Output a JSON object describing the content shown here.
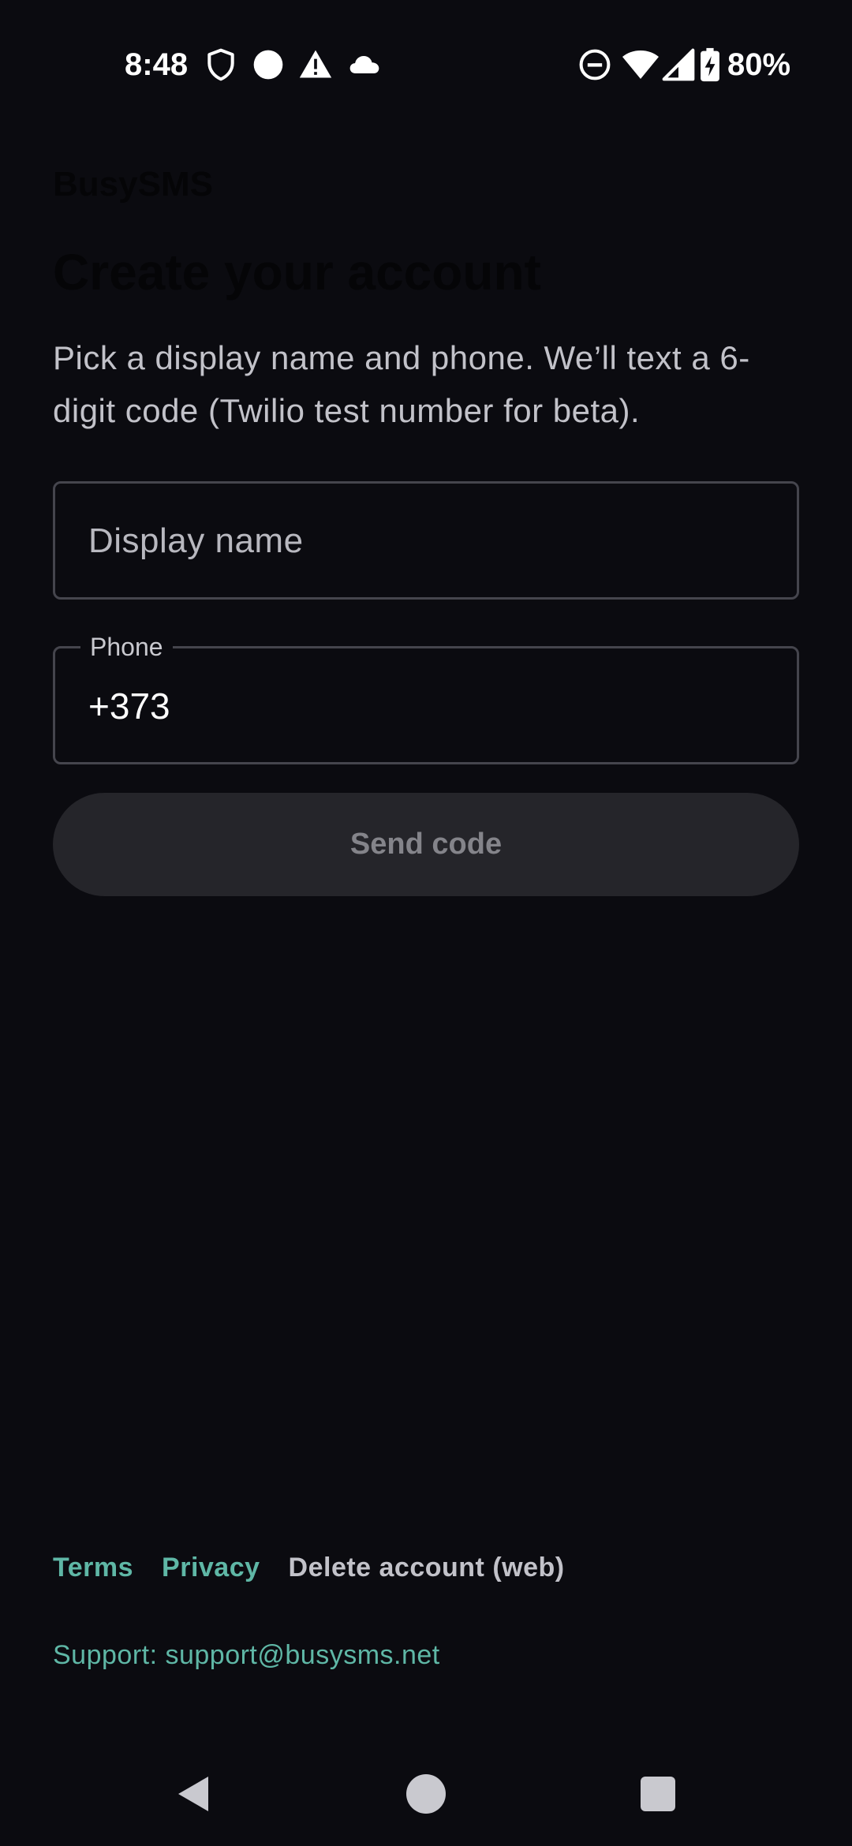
{
  "status_bar": {
    "time": "8:48",
    "battery_percent": "80%",
    "left_icons": [
      "shield-icon",
      "circle-dot-icon",
      "warning-icon",
      "cloud-icon"
    ],
    "right_icons": [
      "do-not-disturb-icon",
      "wifi-icon",
      "signal-icon",
      "battery-charging-icon"
    ]
  },
  "header": {
    "brand": "BusySMS",
    "title": "Create your account",
    "subtitle": "Pick a display name and phone. We’ll text a 6-digit code (Twilio test number for beta)."
  },
  "form": {
    "display_name": {
      "placeholder": "Display name",
      "value": ""
    },
    "phone": {
      "label": "Phone",
      "value": "+373"
    },
    "send_button_label": "Send code"
  },
  "footer": {
    "terms_label": "Terms",
    "privacy_label": "Privacy",
    "delete_account_label": "Delete account (web)",
    "support_text": "Support: support@busysms.net"
  },
  "colors": {
    "background": "#0b0b10",
    "accent": "#5fb7a6",
    "button_disabled_bg": "#25252a",
    "button_disabled_text": "#84848a"
  },
  "nav_bar": {
    "icons": [
      "back-icon",
      "home-icon",
      "recents-icon"
    ]
  }
}
